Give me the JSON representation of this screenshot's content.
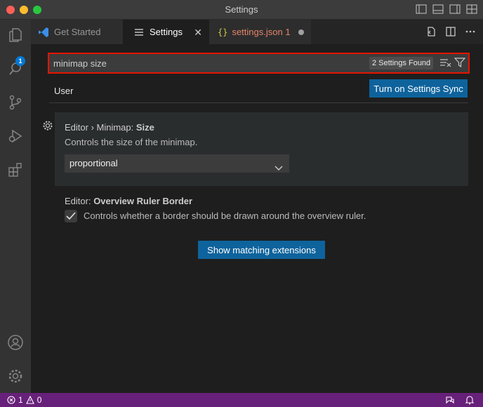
{
  "window": {
    "title": "Settings"
  },
  "activity_bar": {
    "explorer_badge": "1"
  },
  "tabs": {
    "get_started": "Get Started",
    "settings": "Settings",
    "settings_json": "settings.json 1"
  },
  "search": {
    "value": "minimap size",
    "results_count": "2 Settings Found"
  },
  "scope": {
    "user_tab": "User",
    "sync_button": "Turn on Settings Sync"
  },
  "settings": [
    {
      "category": "Editor › Minimap: ",
      "name": "Size",
      "description": "Controls the size of the minimap.",
      "value": "proportional"
    },
    {
      "category": "Editor: ",
      "name": "Overview Ruler Border",
      "description": "Controls whether a border should be drawn around the overview ruler.",
      "checked": true
    }
  ],
  "extensions_button": "Show matching extensions",
  "status_bar": {
    "errors": "1",
    "warnings": "0"
  },
  "colors": {
    "accent": "#0e639c",
    "status_bar": "#68217a",
    "highlight_border": "#e51400"
  }
}
